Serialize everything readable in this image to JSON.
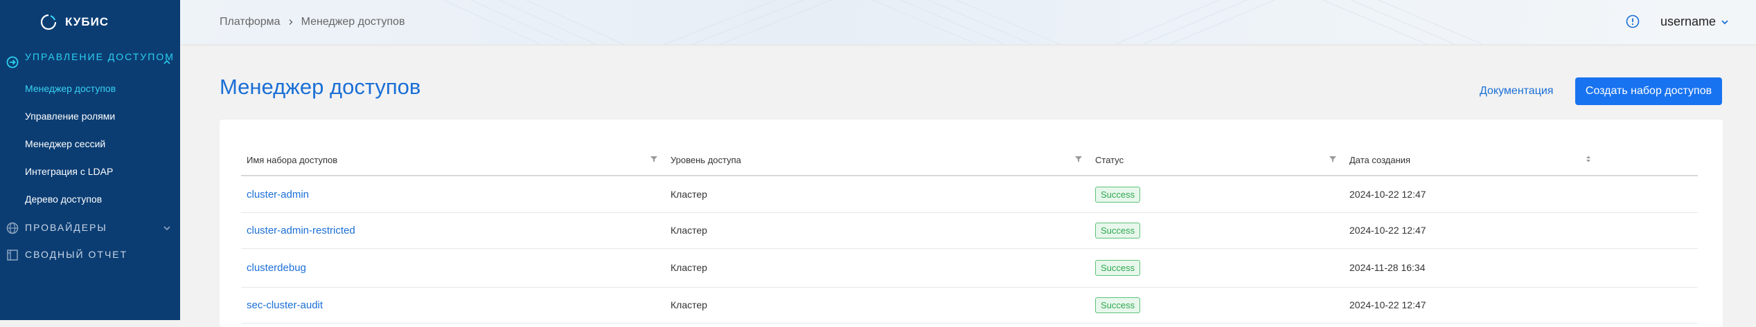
{
  "app": {
    "logo_text": "КУБИС"
  },
  "sidebar": {
    "sections": [
      {
        "label": "Управление доступом",
        "icon": "access-icon",
        "expanded": true,
        "active": true
      },
      {
        "label": "Провайдеры",
        "icon": "globe-icon",
        "expanded": false
      },
      {
        "label": "Сводный отчет",
        "icon": "report-icon"
      }
    ],
    "items": [
      {
        "label": "Менеджер доступов",
        "active": true
      },
      {
        "label": "Управление ролями"
      },
      {
        "label": "Менеджер сессий"
      },
      {
        "label": "Интеграция с LDAP"
      },
      {
        "label": "Дерево доступов"
      }
    ]
  },
  "header": {
    "breadcrumb": [
      "Платформа",
      "Менеджер доступов"
    ],
    "username": "username"
  },
  "main": {
    "title": "Менеджер доступов",
    "doc_link": "Документация",
    "create_button": "Создать набор доступов"
  },
  "table": {
    "columns": [
      "Имя набора доступов",
      "Уровень доступа",
      "Статус",
      "Дата создания"
    ],
    "rows": [
      {
        "name": "cluster-admin",
        "level": "Кластер",
        "status": "Success",
        "date": "2024-10-22 12:47"
      },
      {
        "name": "cluster-admin-restricted",
        "level": "Кластер",
        "status": "Success",
        "date": "2024-10-22 12:47"
      },
      {
        "name": "clusterdebug",
        "level": "Кластер",
        "status": "Success",
        "date": "2024-11-28 16:34"
      },
      {
        "name": "sec-cluster-audit",
        "level": "Кластер",
        "status": "Success",
        "date": "2024-10-22 12:47"
      }
    ]
  },
  "colors": {
    "sidebar_bg": "#0b3d73",
    "accent": "#1a6fd6",
    "active_nav": "#39d3f2",
    "primary_button": "#1873f0",
    "success": "#2ea84f"
  }
}
